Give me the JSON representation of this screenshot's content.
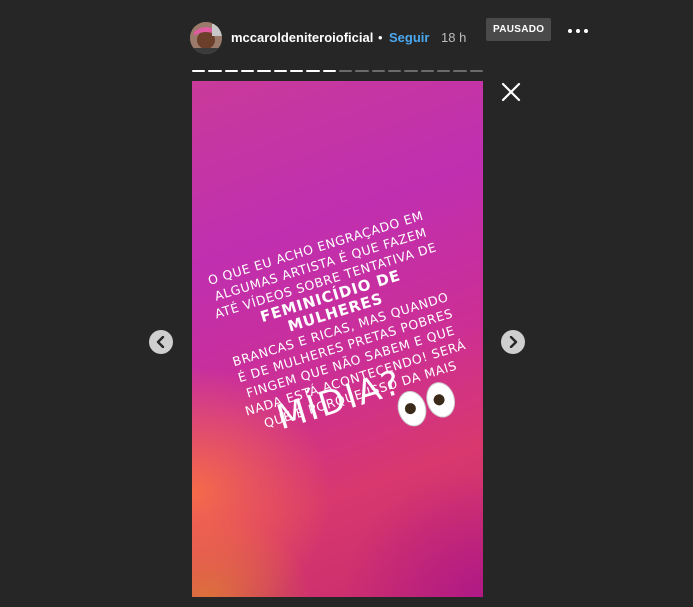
{
  "header": {
    "username": "mccaroldeniteroioficial",
    "separator": "•",
    "follow_label": "Seguir",
    "time": "18 h",
    "status_badge": "PAUSADO",
    "more_icon": "more-horizontal-icon",
    "close_icon": "close-icon"
  },
  "progress": {
    "total_segments": 18,
    "viewed_segments": 9,
    "colors": {
      "viewed": "#ffffff",
      "pending": "#6b6b6b"
    }
  },
  "story": {
    "text_lines": [
      "O QUE EU ACHO ENGRAÇADO EM",
      "ALGUMAS ARTISTA É QUE FAZEM",
      "ATÉ VÍDEOS SOBRE TENTATIVA DE",
      "FEMINICÍDIO DE MULHERES",
      "BRANCAS E RICAS, MAS QUANDO",
      "É DE MULHERES PRETAS POBRES",
      "FINGEM QUE NÃO SABEM E QUE",
      "NADA ESTÁ ACONTECENDO! SERÁ",
      "QUE É PORQUE ISSO DA MAIS"
    ],
    "highlight": "MÍDIA?",
    "emoji": "eyes-emoji"
  },
  "navigation": {
    "prev_icon": "chevron-left-icon",
    "next_icon": "chevron-right-icon"
  },
  "colors": {
    "background": "#262626",
    "follow": "#4aa8f0"
  }
}
